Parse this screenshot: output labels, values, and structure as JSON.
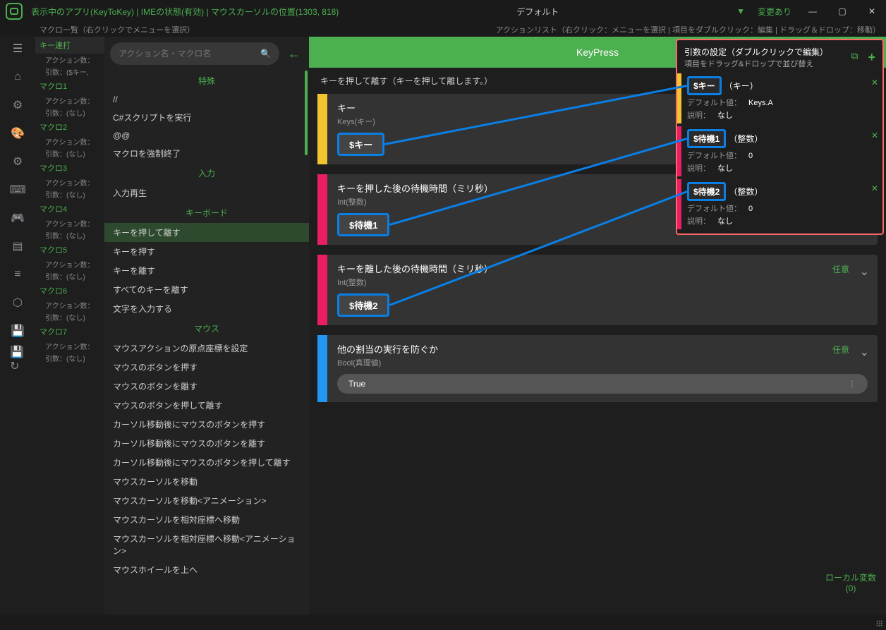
{
  "titlebar": {
    "status": "表示中のアプリ(KeyToKey)  |  IMEの状態(有効)  |  マウスカーソルの位置(1303, 818)",
    "profile": "デフォルト",
    "dropdown": "▼",
    "changes": "変更あり"
  },
  "subheader": {
    "left": "マクロ一覧（右クリックでメニューを選択）",
    "right": "アクションリスト（右クリック：メニューを選択  |  項目をダブルクリック：編集  |  ドラッグ＆ドロップ：移動）"
  },
  "macros": [
    {
      "name": "キー連打",
      "sub1": "アクション数：",
      "sub2": "引数：($キー,"
    },
    {
      "name": "マクロ1",
      "sub1": "アクション数：",
      "sub2": "引数：(なし)"
    },
    {
      "name": "マクロ2",
      "sub1": "アクション数：",
      "sub2": "引数：(なし)"
    },
    {
      "name": "マクロ3",
      "sub1": "アクション数：",
      "sub2": "引数：(なし)"
    },
    {
      "name": "マクロ4",
      "sub1": "アクション数：",
      "sub2": "引数：(なし)"
    },
    {
      "name": "マクロ5",
      "sub1": "アクション数：",
      "sub2": "引数：(なし)"
    },
    {
      "name": "マクロ6",
      "sub1": "アクション数：",
      "sub2": "引数：(なし)"
    },
    {
      "name": "マクロ7",
      "sub1": "アクション数：",
      "sub2": "引数：(なし)"
    }
  ],
  "search": {
    "placeholder": "アクション名・マクロ名"
  },
  "categories": {
    "special": "特殊",
    "input": "入力",
    "keyboard": "キーボード",
    "mouse": "マウス"
  },
  "actions": {
    "special": [
      "//",
      "C#スクリプトを実行",
      "@@",
      "マクロを強制終了"
    ],
    "input": [
      "入力再生"
    ],
    "keyboard": [
      "キーを押して離す",
      "キーを押す",
      "キーを離す",
      "すべてのキーを離す",
      "文字を入力する"
    ],
    "mouse": [
      "マウスアクションの原点座標を設定",
      "マウスのボタンを押す",
      "マウスのボタンを離す",
      "マウスのボタンを押して離す",
      "カーソル移動後にマウスのボタンを押す",
      "カーソル移動後にマウスのボタンを離す",
      "カーソル移動後にマウスのボタンを押して離す",
      "マウスカーソルを移動",
      "マウスカーソルを移動<アニメーション>",
      "マウスカーソルを相対座標へ移動",
      "マウスカーソルを相対座標へ移動<アニメーション>",
      "マウスホイールを上へ"
    ]
  },
  "editor": {
    "title": "KeyPress",
    "desc": "キーを押して離す（キーを押して離します。）"
  },
  "params": [
    {
      "bar": "bar-yellow",
      "title": "キー",
      "type": "Keys(キー)",
      "value": "$キー"
    },
    {
      "bar": "bar-pink",
      "title": "キーを押した後の待機時間（ミリ秒）",
      "type": "Int(整数)",
      "value": "$待機1"
    },
    {
      "bar": "bar-pink",
      "title": "キーを離した後の待機時間（ミリ秒）",
      "type": "Int(整数)",
      "value": "$待機2",
      "optional": "任意"
    },
    {
      "bar": "bar-blue",
      "title": "他の割当の実行を防ぐか",
      "type": "Bool(真理値)",
      "value": "True",
      "optional": "任意",
      "plain": true
    }
  ],
  "argsPanel": {
    "title": "引数の設定（ダブルクリックで編集）",
    "sub": "項目をドラッグ&ドロップで並び替え",
    "items": [
      {
        "bar": "bar-yellow",
        "name": "$キー",
        "type": "（キー）",
        "def": "デフォルト値：",
        "defval": "Keys.A",
        "desc": "説明：",
        "descval": "なし"
      },
      {
        "bar": "bar-pink",
        "name": "$待機1",
        "type": "（整数）",
        "def": "デフォルト値：",
        "defval": "0",
        "desc": "説明：",
        "descval": "なし"
      },
      {
        "bar": "bar-pink",
        "name": "$待機2",
        "type": "（整数）",
        "def": "デフォルト値：",
        "defval": "0",
        "desc": "説明：",
        "descval": "なし"
      }
    ]
  },
  "localVars": {
    "label": "ローカル変数",
    "count": "(0)"
  }
}
